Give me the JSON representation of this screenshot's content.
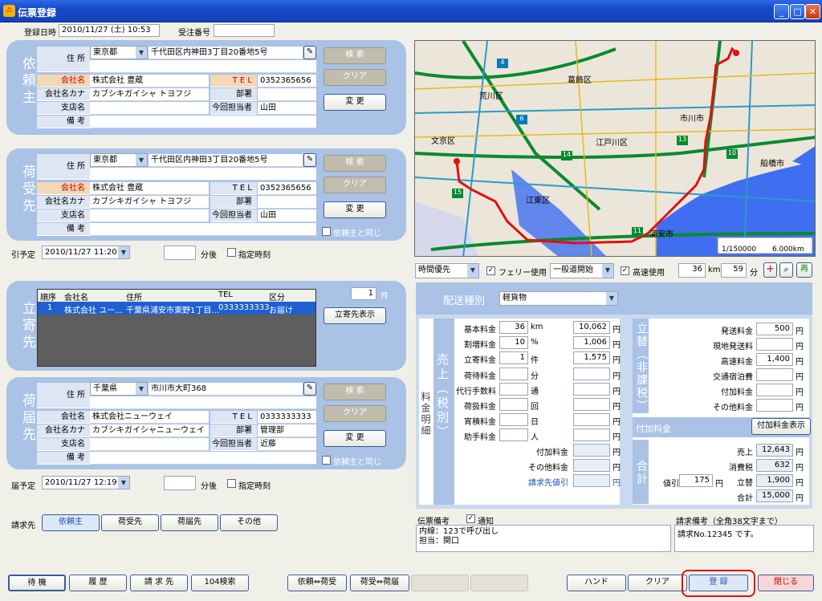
{
  "window": {
    "title": "伝票登録"
  },
  "header": {
    "reg_label": "登録日時",
    "reg_value": "2010/11/27 (土) 10:53",
    "recv_label": "受注番号",
    "recv_value": ""
  },
  "client": {
    "title": "依頼主",
    "addr_label": "住 所",
    "pref": "東京都",
    "address": "千代田区内神田3丁目20番地5号",
    "company_label": "会社名",
    "company": "株式会社 豊蔵",
    "tel_label": "T E L",
    "tel": "0352365656",
    "kana_label": "会社名カナ",
    "kana": "カブシキガイシャ トヨフジ",
    "dept_label": "部署",
    "dept": "",
    "branch_label": "支店名",
    "branch": "",
    "staff_label": "今回担当者",
    "staff": "山田",
    "note_label": "備 考",
    "note": "",
    "search": "検 索",
    "clear": "クリア",
    "change": "変 更"
  },
  "receiver": {
    "title": "荷受先",
    "addr_label": "住 所",
    "pref": "東京都",
    "address": "千代田区内神田3丁目20番地5号",
    "company_label": "会社名",
    "company": "株式会社 豊蔵",
    "tel_label": "T E L",
    "tel": "0352365656",
    "kana_label": "会社名カナ",
    "kana": "カブシキガイシャ トヨフジ",
    "dept_label": "部署",
    "dept": "",
    "branch_label": "支店名",
    "branch": "",
    "staff_label": "今回担当者",
    "staff": "山田",
    "note_label": "備 考",
    "note": "",
    "search": "検 索",
    "clear": "クリア",
    "change": "変 更",
    "same": "依頼主と同じ"
  },
  "pickup": {
    "label": "引予定",
    "datetime": "2010/11/27 11:20",
    "after": "分後",
    "fixed": "指定時刻"
  },
  "stopover": {
    "title": "立寄先",
    "count": "1",
    "count_unit": "件",
    "headers": [
      "順序",
      "会社名",
      "住所",
      "TEL",
      "区分"
    ],
    "rows": [
      [
        "1",
        "株式会社 ユー...",
        "千葉県浦安市東野1丁目...",
        "0333333333",
        "お届け"
      ]
    ],
    "show_button": "立寄先表示"
  },
  "delivery": {
    "title": "荷届先",
    "addr_label": "住 所",
    "pref": "千葉県",
    "address": "市川市大町368",
    "company_label": "会社名",
    "company": "株式会社ニューウェイ",
    "tel_label": "T E L",
    "tel": "0333333333",
    "kana_label": "会社名カナ",
    "kana": "カブシキガイシャニューウェイ",
    "dept_label": "部署",
    "dept": "管理部",
    "branch_label": "支店名",
    "branch": "",
    "staff_label": "今回担当者",
    "staff": "近藤",
    "note_label": "備 考",
    "note": "",
    "search": "検 索",
    "clear": "クリア",
    "change": "変 更",
    "same": "依頼主と同じ"
  },
  "arrival": {
    "label": "届予定",
    "datetime": "2010/11/27 12:19",
    "after": "分後",
    "fixed": "指定時刻"
  },
  "billing": {
    "label": "請求先",
    "options": [
      "依頼主",
      "荷受先",
      "荷届先",
      "その他"
    ]
  },
  "map": {
    "places": [
      "葛飾区",
      "荒川区",
      "市川市",
      "文京区",
      "江戸川区",
      "船橋市",
      "江東区",
      "浦安市"
    ],
    "scale_ratio": "1/150000",
    "scale_dist": "6.000km",
    "route_signs": [
      "4",
      "6",
      "14",
      "15",
      "11",
      "13",
      "10"
    ]
  },
  "route": {
    "priority": "時間優先",
    "ferry": "フェリー使用",
    "road": "一般道開始",
    "highway": "高速使用",
    "km": "36",
    "km_unit": "km",
    "min": "59",
    "min_unit": "分",
    "re": "再"
  },
  "fare": {
    "type_label": "配送種別",
    "type": "軽貨物",
    "side_label": "料金明細",
    "sales_label": "売上（税別）",
    "sales": [
      [
        "基本料金",
        "36",
        "km",
        "10,062",
        "円"
      ],
      [
        "割増料金",
        "10",
        "%",
        "1,006",
        "円"
      ],
      [
        "立寄料金",
        "1",
        "件",
        "1,575",
        "円"
      ],
      [
        "荷待料金",
        "",
        "分",
        "",
        "円"
      ],
      [
        "代行手数料",
        "",
        "通",
        "",
        "円"
      ],
      [
        "荷扱料金",
        "",
        "回",
        "",
        "円"
      ],
      [
        "宵積料金",
        "",
        "日",
        "",
        "円"
      ],
      [
        "助手料金",
        "",
        "人",
        "",
        "円"
      ]
    ],
    "extra": [
      [
        "付加料金",
        "",
        "円"
      ],
      [
        "その他料金",
        "",
        "円"
      ],
      [
        "請求先値引",
        "",
        "円"
      ]
    ],
    "advance_label": "立替（非課税）",
    "advance": [
      [
        "発送料金",
        "500",
        "円"
      ],
      [
        "現地発送料",
        "",
        "円"
      ],
      [
        "高速料金",
        "1,400",
        "円"
      ],
      [
        "交通宿泊費",
        "",
        "円"
      ],
      [
        "付加料金",
        "",
        "円"
      ],
      [
        "その他料金",
        "",
        "円"
      ]
    ],
    "addon_label": "付加料金",
    "addon_button": "付加料金表示",
    "total_label": "合計",
    "discount_label": "値引",
    "discount": "175",
    "discount_unit": "円",
    "totals": [
      [
        "売上",
        "12,643",
        "円"
      ],
      [
        "消費税",
        "632",
        "円"
      ],
      [
        "立替",
        "1,900",
        "円"
      ],
      [
        "合計",
        "15,000",
        "円"
      ]
    ]
  },
  "memo": {
    "label": "伝票備考",
    "notify": "通知",
    "text1": "内線：123で呼び出し",
    "text2": "担当：関口",
    "bill_label": "請求備考（全角38文字まで）",
    "bill_text": "請求No.12345 です。"
  },
  "footer": {
    "buttons": [
      "待 機",
      "履 歴",
      "請 求 先",
      "104検索"
    ],
    "swap": [
      "依頼⇔荷受",
      "荷受⇔荷届"
    ],
    "right": [
      "ハンド",
      "クリア",
      "登 録",
      "閉じる"
    ]
  }
}
